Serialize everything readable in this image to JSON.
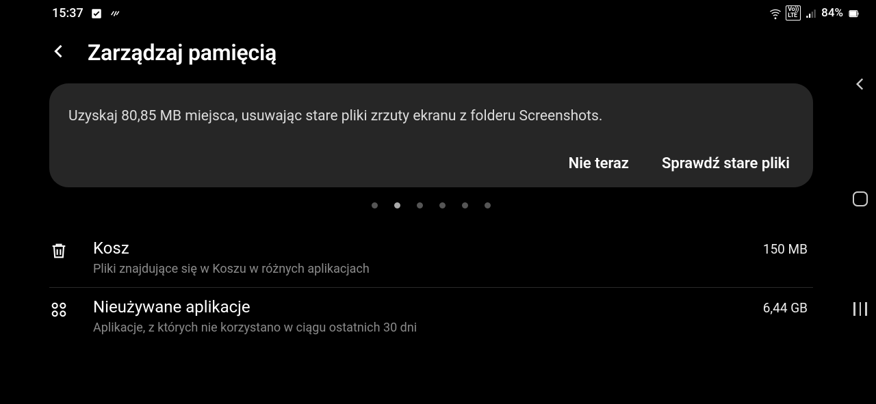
{
  "statusbar": {
    "time": "15:37",
    "battery": "84%"
  },
  "header": {
    "title": "Zarządzaj pamięcią"
  },
  "card": {
    "message": "Uzyskaj 80,85 MB miejsca, usuwając stare pliki zrzuty ekranu z folderu Screenshots.",
    "not_now": "Nie teraz",
    "check_old": "Sprawdź stare pliki"
  },
  "pager": {
    "count": 6,
    "active_index": 1
  },
  "list": [
    {
      "title": "Kosz",
      "subtitle": "Pliki znajdujące się w Koszu w różnych aplikacjach",
      "value": "150 MB"
    },
    {
      "title": "Nieużywane aplikacje",
      "subtitle": "Aplikacje, z których nie korzystano w ciągu ostatnich 30 dni",
      "value": "6,44 GB"
    }
  ]
}
